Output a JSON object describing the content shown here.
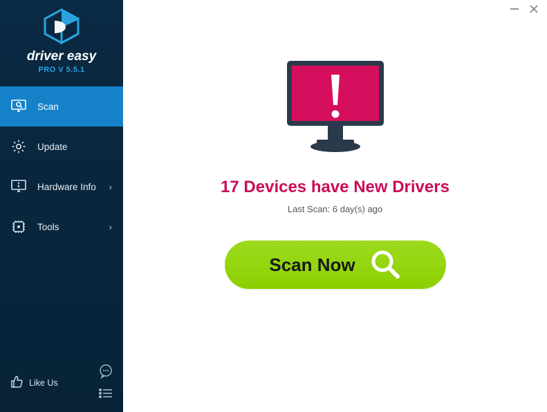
{
  "app": {
    "name": "driver easy",
    "version": "PRO V 5.5.1"
  },
  "sidebar": {
    "items": [
      {
        "label": "Scan",
        "icon": "scan-monitor-icon",
        "active": true,
        "expandable": false
      },
      {
        "label": "Update",
        "icon": "gear-icon",
        "active": false,
        "expandable": false
      },
      {
        "label": "Hardware Info",
        "icon": "hardware-info-icon",
        "active": false,
        "expandable": true
      },
      {
        "label": "Tools",
        "icon": "tools-icon",
        "active": false,
        "expandable": true
      }
    ],
    "like_us_label": "Like Us"
  },
  "main": {
    "headline": "17 Devices have New Drivers",
    "last_scan": "Last Scan: 6 day(s) ago",
    "scan_button_label": "Scan Now"
  },
  "colors": {
    "accent_magenta": "#cb0b59",
    "scan_green": "#8fd400",
    "brand_blue": "#2aa3e0"
  }
}
